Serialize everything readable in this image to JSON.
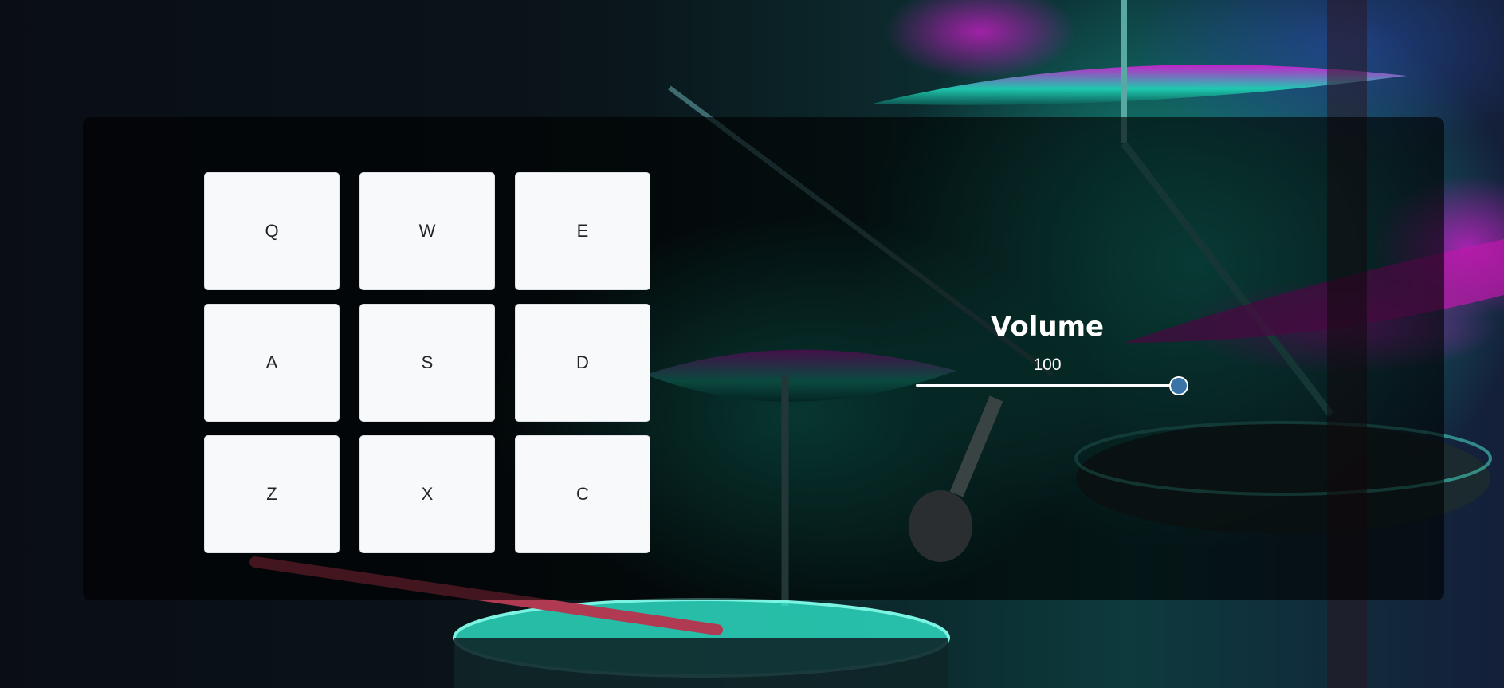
{
  "pads": [
    {
      "key": "Q"
    },
    {
      "key": "W"
    },
    {
      "key": "E"
    },
    {
      "key": "A"
    },
    {
      "key": "S"
    },
    {
      "key": "D"
    },
    {
      "key": "Z"
    },
    {
      "key": "X"
    },
    {
      "key": "C"
    }
  ],
  "volume": {
    "label": "Volume",
    "value": "100",
    "level": 1.0
  },
  "colors": {
    "accent_teal": "#1de9c7",
    "accent_magenta": "#d21be0",
    "pad_background": "#f8f9fa",
    "slider_thumb": "#3a73a8"
  }
}
